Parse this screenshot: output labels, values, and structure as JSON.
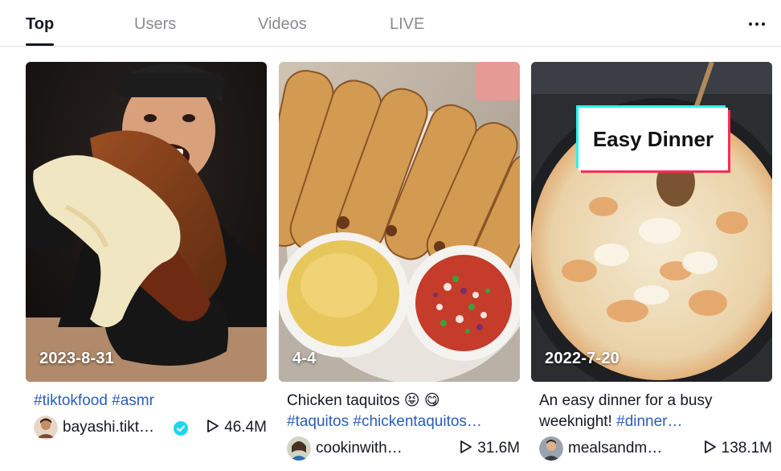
{
  "tabs": [
    {
      "label": "Top",
      "active": true
    },
    {
      "label": "Users",
      "active": false
    },
    {
      "label": "Videos",
      "active": false
    },
    {
      "label": "LIVE",
      "active": false
    }
  ],
  "more_icon": "more-horizontal-icon",
  "cards": [
    {
      "date": "2023-8-31",
      "desc_text": "",
      "desc_tags": "#tiktokfood #asmr",
      "username": "bayashi.tikt…",
      "verified": true,
      "plays": "46.4M"
    },
    {
      "date": "4-4",
      "desc_text": "Chicken taquitos 😝 😋",
      "desc_tags": "#taquitos #chickentaquitos…",
      "username": "cookinwith…",
      "verified": false,
      "plays": "31.6M"
    },
    {
      "date": "2022-7-20",
      "overlay_text": "Easy Dinner",
      "desc_text": "An easy dinner for a busy",
      "desc_text2": "weeknight!",
      "desc_tags": "#dinner…",
      "username": "mealsandm…",
      "verified": false,
      "plays": "138.1M"
    }
  ],
  "colors": {
    "hashtag": "#2b5db9",
    "verified": "#20d5ec",
    "overlay_cyan": "#25f4ee",
    "overlay_red": "#fe2c55"
  }
}
